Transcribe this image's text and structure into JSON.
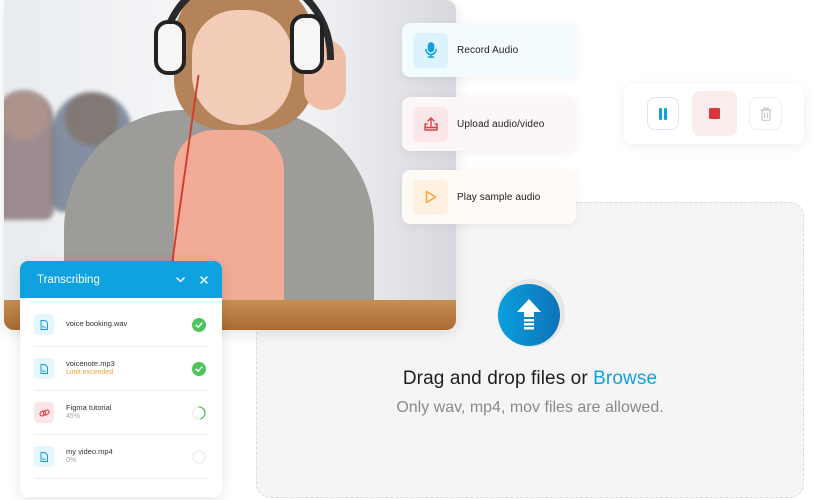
{
  "actions": {
    "record": {
      "label": "Record Audio",
      "icon": "microphone-icon",
      "color": "#10a0de"
    },
    "upload": {
      "label": "Upload audio/video",
      "icon": "upload-icon",
      "color": "#d9414a"
    },
    "play": {
      "label": "Play sample audio",
      "icon": "play-icon",
      "color": "#f3a33d"
    }
  },
  "recorder": {
    "pause_icon": "pause-icon",
    "stop_icon": "stop-icon",
    "delete_icon": "trash-icon",
    "pause_color": "#10a0de",
    "stop_color": "#d9363e",
    "delete_color": "#c8c8c8"
  },
  "dropzone": {
    "title": "Drag and drop files or ",
    "browse_label": "Browse",
    "subtitle": "Only wav, mp4, mov files are allowed.",
    "icon": "upload-arrow-icon",
    "accent": "#10a0de"
  },
  "transcribing": {
    "title": "Transcribing",
    "header_color": "#0fa2e0",
    "collapse_icon": "chevron-down-icon",
    "close_icon": "close-icon",
    "files": [
      {
        "name": "voice booking.wav",
        "status": "",
        "icon": "audio-file-icon",
        "state": "done"
      },
      {
        "name": "voicenote.mp3",
        "status": "Limit exceeded",
        "icon": "audio-file-icon",
        "state": "done"
      },
      {
        "name": "Figma tutorial",
        "status": "45%",
        "icon": "link-icon",
        "state": "progress",
        "progress": 0.45
      },
      {
        "name": "my video.mp4",
        "status": "0%",
        "icon": "audio-file-icon",
        "state": "progress",
        "progress": 0
      }
    ]
  }
}
